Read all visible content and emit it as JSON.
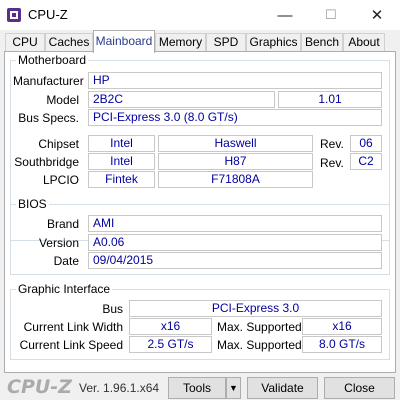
{
  "window": {
    "title": "CPU-Z",
    "minimize": "—",
    "maximize": "☐",
    "close": "✕",
    "icon": "cpu-z-app-icon"
  },
  "tabs": [
    {
      "label": "CPU"
    },
    {
      "label": "Caches"
    },
    {
      "label": "Mainboard",
      "active": true
    },
    {
      "label": "Memory"
    },
    {
      "label": "SPD"
    },
    {
      "label": "Graphics"
    },
    {
      "label": "Bench"
    },
    {
      "label": "About"
    }
  ],
  "motherboard": {
    "legend": "Motherboard",
    "manufacturer_label": "Manufacturer",
    "manufacturer": "HP",
    "model_label": "Model",
    "model": "2B2C",
    "model_rev": "1.01",
    "bus_label": "Bus Specs.",
    "bus": "PCI-Express 3.0 (8.0 GT/s)",
    "chipset_label": "Chipset",
    "chipset_vendor": "Intel",
    "chipset_name": "Haswell",
    "chipset_rev_label": "Rev.",
    "chipset_rev": "06",
    "southbridge_label": "Southbridge",
    "southbridge_vendor": "Intel",
    "southbridge_name": "H87",
    "southbridge_rev_label": "Rev.",
    "southbridge_rev": "C2",
    "lpcio_label": "LPCIO",
    "lpcio_vendor": "Fintek",
    "lpcio_name": "F71808A"
  },
  "bios": {
    "legend": "BIOS",
    "brand_label": "Brand",
    "brand": "AMI",
    "version_label": "Version",
    "version": "A0.06",
    "date_label": "Date",
    "date": "09/04/2015"
  },
  "graphic": {
    "legend": "Graphic Interface",
    "bus_label": "Bus",
    "bus": "PCI-Express 3.0",
    "link_width_label": "Current Link Width",
    "link_width": "x16",
    "max_width_label": "Max. Supported",
    "max_width": "x16",
    "link_speed_label": "Current Link Speed",
    "link_speed": "2.5 GT/s",
    "max_speed_label": "Max. Supported",
    "max_speed": "8.0 GT/s"
  },
  "footer": {
    "brand": "CPU-Z",
    "version": "Ver. 1.96.1.x64",
    "tools": "Tools",
    "tools_arrow": "▼",
    "validate": "Validate",
    "close": "Close"
  }
}
